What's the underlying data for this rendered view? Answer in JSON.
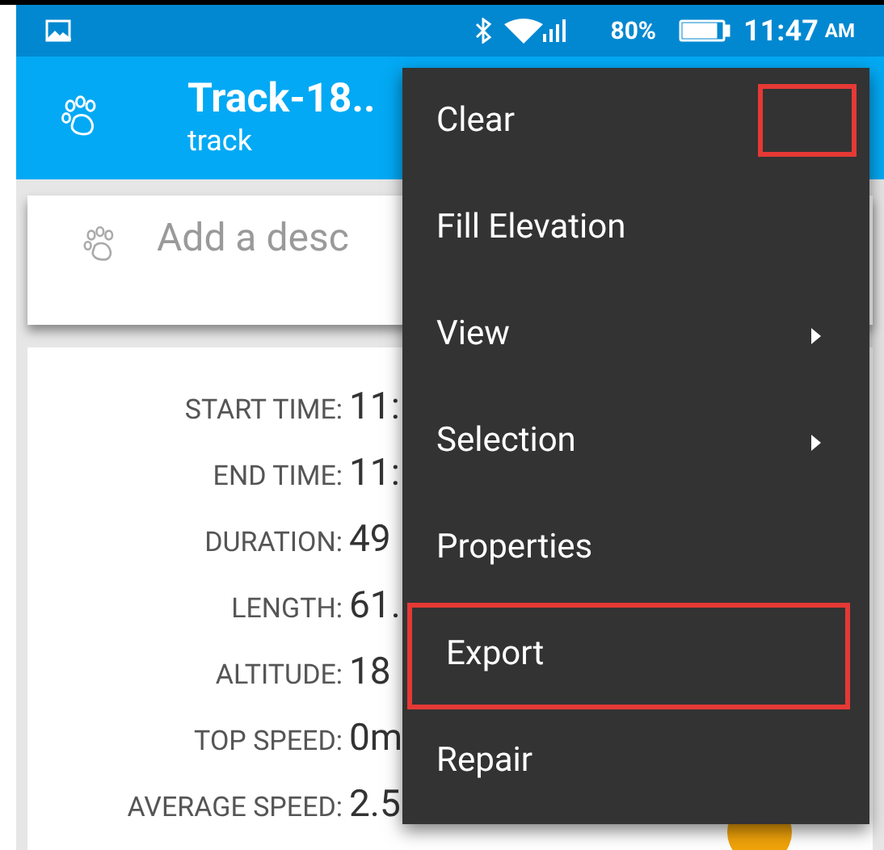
{
  "status_bar": {
    "battery": "80%",
    "time": "11:47",
    "meridiem": "AM"
  },
  "toolbar": {
    "title": "Track-18..",
    "subtitle": "track"
  },
  "description": {
    "placeholder": "Add a desc"
  },
  "stats": [
    {
      "label": "START TIME:",
      "value": "11:"
    },
    {
      "label": "END TIME:",
      "value": "11:"
    },
    {
      "label": "DURATION:",
      "value": "49"
    },
    {
      "label": "LENGTH:",
      "value": "61."
    },
    {
      "label": "ALTITUDE:",
      "value": "18"
    },
    {
      "label": "TOP SPEED:",
      "value": "0m"
    },
    {
      "label": "AVERAGE SPEED:",
      "value": "2.5"
    }
  ],
  "menu": {
    "corner_highlighted": true,
    "items": [
      {
        "label": "Clear",
        "has_submenu": false,
        "highlighted": false
      },
      {
        "label": "Fill Elevation",
        "has_submenu": false,
        "highlighted": false
      },
      {
        "label": "View",
        "has_submenu": true,
        "highlighted": false
      },
      {
        "label": "Selection",
        "has_submenu": true,
        "highlighted": false
      },
      {
        "label": "Properties",
        "has_submenu": false,
        "highlighted": false
      },
      {
        "label": "Export",
        "has_submenu": false,
        "highlighted": true
      },
      {
        "label": "Repair",
        "has_submenu": false,
        "highlighted": false
      }
    ]
  }
}
